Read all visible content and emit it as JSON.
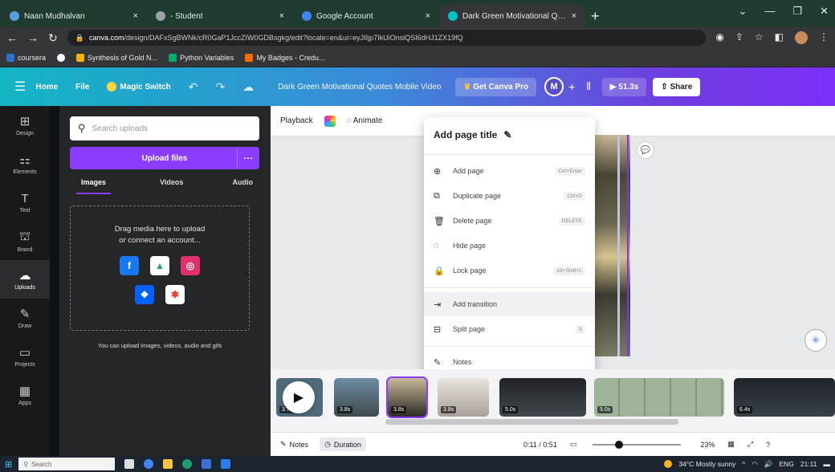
{
  "browser": {
    "tabs": [
      {
        "label": "Naan Mudhalvan",
        "color": "#5aa0e0"
      },
      {
        "label": "- Student",
        "color": "#9aa0a6"
      },
      {
        "label": "Google Account",
        "color": "#4285f4"
      },
      {
        "label": "Dark Green Motivational Quot...",
        "color": "#00c4cc",
        "active": true
      }
    ],
    "new_tab": "+",
    "url_host": "canva.com",
    "url_path": "/design/DAFxSgBWNk/cR0GaP1JccZIW0GDBsgkg/edit?locale=en&ui=eyJIIjp7IkUiOnsiQSI6dHJ1ZX19fQ",
    "bookmarks": [
      "coursera",
      "",
      "Synthesis of Gold N...",
      "Python Variables",
      "My Badges - Credu..."
    ]
  },
  "canva": {
    "header": {
      "home": "Home",
      "file": "File",
      "magic_switch": "Magic Switch",
      "doc_title": "Dark Green Motivational Quotes Mobile Video",
      "get_pro": "Get Canva Pro",
      "avatar": "M",
      "play_duration": "51.3s",
      "share": "Share"
    },
    "rail": [
      {
        "icon": "⊞",
        "label": "Design"
      },
      {
        "icon": "⚏",
        "label": "Elements"
      },
      {
        "icon": "T",
        "label": "Text"
      },
      {
        "icon": "⛫",
        "label": "Brand"
      },
      {
        "icon": "☁",
        "label": "Uploads",
        "active": true
      },
      {
        "icon": "✎",
        "label": "Draw"
      },
      {
        "icon": "▭",
        "label": "Projects"
      },
      {
        "icon": "▦",
        "label": "Apps"
      }
    ],
    "uploads": {
      "search_placeholder": "Search uploads",
      "upload_button": "Upload files",
      "more": "···",
      "tabs": [
        "Images",
        "Videos",
        "Audio"
      ],
      "drop_text_1": "Drag media here to upload",
      "drop_text_2": "or connect an account...",
      "services": [
        {
          "name": "Facebook",
          "color": "#1877f2",
          "glyph": "f"
        },
        {
          "name": "Google Drive",
          "color": "#ffffff",
          "glyph": "▲"
        },
        {
          "name": "Instagram",
          "color": "#e1306c",
          "glyph": "◎"
        },
        {
          "name": "Dropbox",
          "color": "#0061fe",
          "glyph": "❖"
        },
        {
          "name": "Google Photos",
          "color": "#ffffff",
          "glyph": "✱"
        }
      ],
      "note": "You can upload images, videos, audio and gifs"
    },
    "toolbar": {
      "playback": "Playback",
      "animate": "Animate"
    },
    "context_menu": {
      "title": "Add page title",
      "items": [
        {
          "icon": "⊕",
          "label": "Add page",
          "shortcut": "Ctrl+Enter"
        },
        {
          "icon": "⧉",
          "label": "Duplicate page",
          "shortcut": "Ctrl+D"
        },
        {
          "icon": "🗑",
          "label": "Delete page",
          "shortcut": "DELETE"
        },
        {
          "icon": "◌",
          "label": "Hide page",
          "shortcut": ""
        },
        {
          "icon": "🔒",
          "label": "Lock page",
          "shortcut": "Alt+Shift+L"
        },
        {
          "icon": "⇥",
          "label": "Add transition",
          "shortcut": ""
        },
        {
          "icon": "⊟",
          "label": "Split page",
          "shortcut": "S"
        },
        {
          "icon": "✎",
          "label": "Notes",
          "shortcut": ""
        }
      ]
    },
    "timeline": {
      "clips": [
        {
          "duration": "3.7s",
          "color": "#4f6a7a"
        },
        {
          "duration": "3.8s",
          "color": "#3f4a4c"
        },
        {
          "duration": "3.8s",
          "color": "#c7c1b9"
        },
        {
          "duration": "5.0s",
          "color": "#2a2e30"
        },
        {
          "duration": "5.0s",
          "color": "#9fb49a"
        },
        {
          "duration": "6.4s",
          "color": "#2a2f35"
        }
      ]
    },
    "bottom": {
      "notes": "Notes",
      "duration": "Duration",
      "timecode": "0:11 / 0:51",
      "zoom": "23%"
    }
  },
  "taskbar": {
    "search": "Search",
    "weather": "34°C  Mostly sunny",
    "lang": "ENG",
    "time": "21:11"
  }
}
